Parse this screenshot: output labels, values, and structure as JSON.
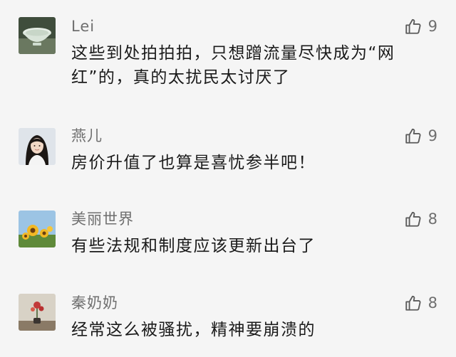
{
  "comments": [
    {
      "nickname": "Lei",
      "text": "这些到处拍拍拍，只想蹭流量尽快成为“网红”的，真的太扰民太讨厌了",
      "likes": "9",
      "avatar": "porcelain-bowl-avatar"
    },
    {
      "nickname": "燕儿",
      "text": "房价升值了也算是喜忧参半吧！",
      "likes": "9",
      "avatar": "woman-portrait-avatar"
    },
    {
      "nickname": "美丽世界",
      "text": "有些法规和制度应该更新出台了",
      "likes": "8",
      "avatar": "sunflower-avatar"
    },
    {
      "nickname": "秦奶奶",
      "text": "经常这么被骚扰，精神要崩溃的",
      "likes": "8",
      "avatar": "flower-vase-avatar"
    }
  ],
  "icons": {
    "like": "thumbs-up-icon"
  },
  "colors": {
    "background": "#f5f5f5",
    "nickname": "#6f6f6f",
    "text": "#1a1a1a"
  }
}
